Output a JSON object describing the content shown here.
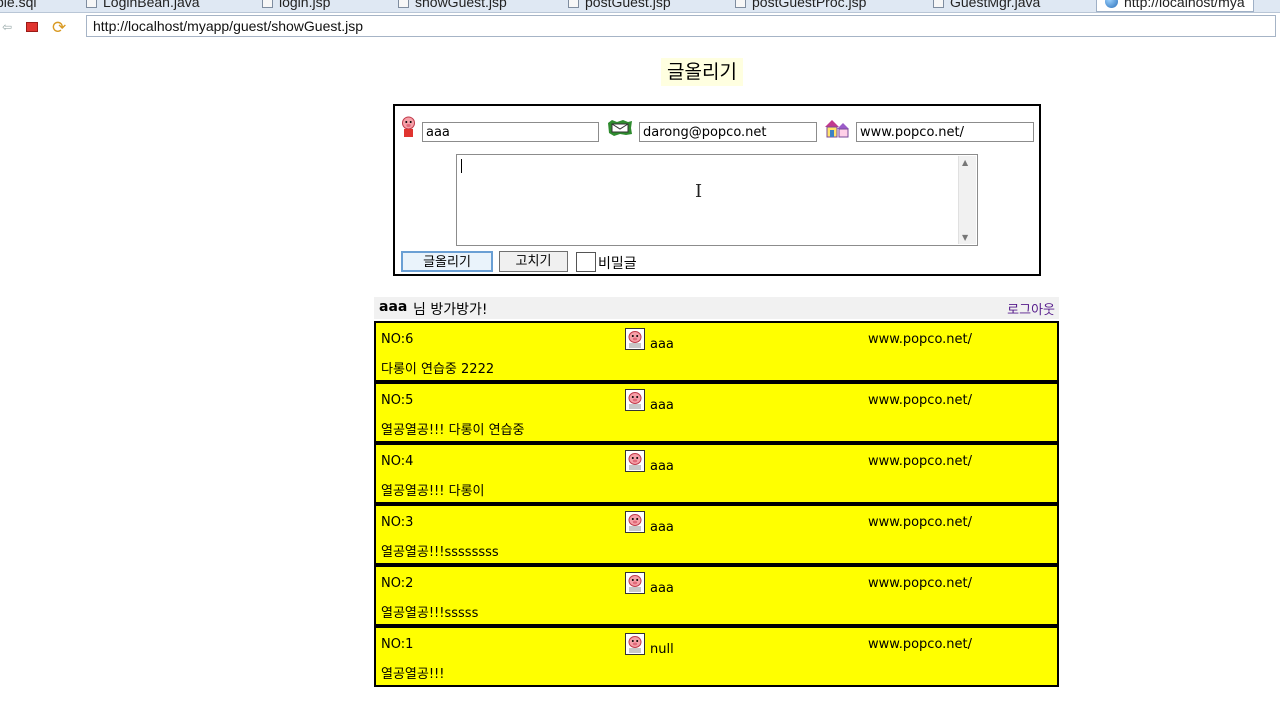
{
  "tabs": [
    {
      "label": "ble.sql"
    },
    {
      "label": "LoginBean.java"
    },
    {
      "label": "login.jsp"
    },
    {
      "label": "showGuest.jsp"
    },
    {
      "label": "postGuest.jsp"
    },
    {
      "label": "postGuestProc.jsp"
    },
    {
      "label": "GuestMgr.java"
    },
    {
      "label": "http://localhost/mya"
    }
  ],
  "address": "http://localhost/myapp/guest/showGuest.jsp",
  "page_title": "글올리기",
  "form": {
    "name_value": "aaa",
    "email_value": "darong@popco.net",
    "homepage_value": "www.popco.net/",
    "content_value": "",
    "submit_label": "글올리기",
    "reset_label": "고치기",
    "secret_label": "비밀글"
  },
  "greeting": {
    "user": "aaa",
    "text": "님 방가방가!",
    "logout": "로그아웃"
  },
  "entries": [
    {
      "no": "NO:6",
      "author": "aaa",
      "homepage": "www.popco.net/",
      "content": "다롱이 연습중 2222"
    },
    {
      "no": "NO:5",
      "author": "aaa",
      "homepage": "www.popco.net/",
      "content": "열공열공!!! 다롱이 연습중"
    },
    {
      "no": "NO:4",
      "author": "aaa",
      "homepage": "www.popco.net/",
      "content": "열공열공!!! 다롱이"
    },
    {
      "no": "NO:3",
      "author": "aaa",
      "homepage": "www.popco.net/",
      "content": "열공열공!!!ssssssss"
    },
    {
      "no": "NO:2",
      "author": "aaa",
      "homepage": "www.popco.net/",
      "content": "열공열공!!!sssss"
    },
    {
      "no": "NO:1",
      "author": "null",
      "homepage": "www.popco.net/",
      "content": "열공열공!!!"
    }
  ],
  "colors": {
    "entry_bg": "#ffff00",
    "title_bg": "#ffffe0",
    "logout_link": "#551a8b"
  }
}
